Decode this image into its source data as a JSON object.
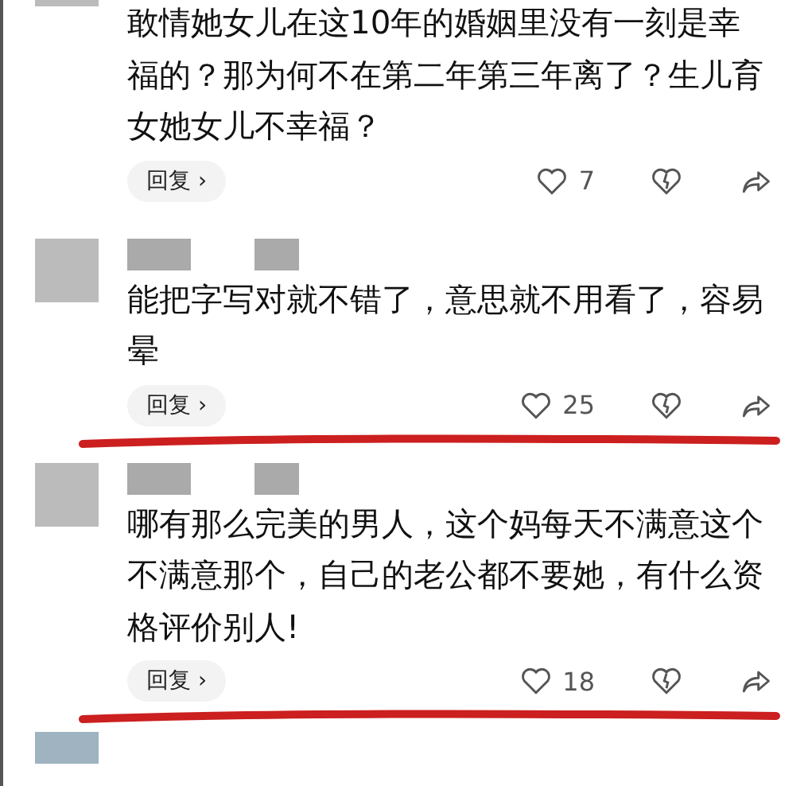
{
  "comments": [
    {
      "kind": "clipped",
      "text": "敢情她女儿在这10年的婚姻里没有一刻是幸福的？那为何不在第二年第三年离了？生儿育女她女儿不幸福？",
      "reply": "回复 ›",
      "likes": "7",
      "struck": false
    },
    {
      "kind": "full",
      "text": "能把字写对就不错了，意思就不用看了，容易晕",
      "reply": "回复 ›",
      "likes": "25",
      "struck": true
    },
    {
      "kind": "full",
      "text": "哪有那么完美的男人，这个妈每天不满意这个不满意那个，自己的老公都不要她，有什么资格评价别人!",
      "reply": "回复 ›",
      "likes": "18",
      "struck": true
    }
  ],
  "more_below": true
}
